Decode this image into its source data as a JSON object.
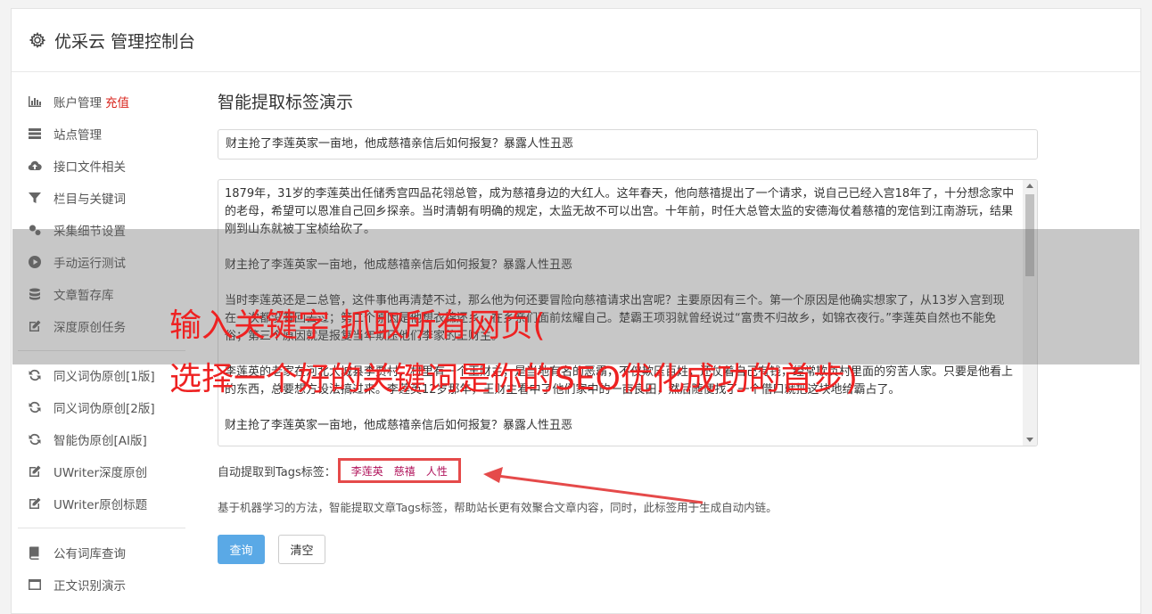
{
  "header": {
    "title": "优采云 管理控制台"
  },
  "sidebar": {
    "items": [
      {
        "label": "账户管理",
        "badge": "充值",
        "icon": "bar-chart-icon"
      },
      {
        "label": "站点管理",
        "icon": "server-icon"
      },
      {
        "label": "接口文件相关",
        "icon": "cloud-upload-icon"
      },
      {
        "label": "栏目与关键词",
        "icon": "filter-icon"
      },
      {
        "label": "采集细节设置",
        "icon": "gears-icon"
      },
      {
        "label": "手动运行测试",
        "icon": "play-circle-icon"
      },
      {
        "label": "文章暂存库",
        "icon": "database-icon"
      },
      {
        "label": "深度原创任务",
        "icon": "edit-icon"
      }
    ],
    "items2": [
      {
        "label": "同义词伪原创[1版]",
        "icon": "refresh-icon"
      },
      {
        "label": "同义词伪原创[2版]",
        "icon": "refresh-icon"
      },
      {
        "label": "智能伪原创[AI版]",
        "icon": "refresh-icon"
      },
      {
        "label": "UWriter深度原创",
        "icon": "edit-icon"
      },
      {
        "label": "UWriter原创标题",
        "icon": "edit-icon"
      }
    ],
    "items3": [
      {
        "label": "公有词库查询",
        "icon": "book-icon"
      },
      {
        "label": "正文识别演示",
        "icon": "window-icon"
      }
    ]
  },
  "main": {
    "title": "智能提取标签演示",
    "title_input": "财主抢了李莲英家一亩地，他成慈禧亲信后如何报复？暴露人性丑恶",
    "paragraphs": [
      "1879年，31岁的李莲英出任储秀宫四品花翎总管，成为慈禧身边的大红人。这年春天，他向慈禧提出了一个请求，说自己已经入宫18年了，十分想念家中的老母，希望可以恩准自己回乡探亲。当时清朝有明确的规定，太监无故不可以出宫。十年前，时任大总管太监的安德海仗着慈禧的宠信到江南游玩，结果刚到山东就被丁宝桢给砍了。",
      "财主抢了李莲英家一亩地，他成慈禧亲信后如何报复？暴露人性丑恶",
      "当时李莲英还是二总管，这件事他再清楚不过，那么他为何还要冒险向慈禧请求出宫呢？主要原因有三个。第一个原因是他确实想家了，从13岁入宫到现在一次都没有回去过；第二个原因是他想衣锦还乡，在乡亲们面前炫耀自己。楚霸王项羽就曾经说过“富贵不归故乡，如锦衣夜行。”李莲英自然也不能免俗；第三个原因就是报复当年欺压他们李家的王财主。",
      "李莲英的老家在河北大城县李贾村，村里有一个王财主，是当地有名的恶霸，不仅欺压百姓，还仗着自己有钱，经常欺负村里面的穷苦人家。只要是他看上的东西，总要想方设法搞过来。李莲英12岁那年，王财主看中了他们家中的一亩良田，然后随便找了一个借口就把这块地给霸占了。",
      "财主抢了李莲英家一亩地，他成慈禧亲信后如何报复？暴露人性丑恶"
    ],
    "tags_label": "自动提取到Tags标签：",
    "tags": [
      "李莲英",
      "慈禧",
      "人性"
    ],
    "description": "基于机器学习的方法，智能提取文章Tags标签，帮助站长更有效聚合文章内容，同时，此标签用于生成自动内链。",
    "query_button": "查询",
    "clear_button": "清空"
  },
  "overlay": {
    "line1": "输入关键字 抓取所有网页(",
    "line2": "选择一个好的关键词是你的SEO优化成功的首步)"
  },
  "colors": {
    "accent": "#5aa9e6",
    "overlay_text": "#ee2222",
    "tag": "#b0125a",
    "badge": "#d9251d"
  }
}
